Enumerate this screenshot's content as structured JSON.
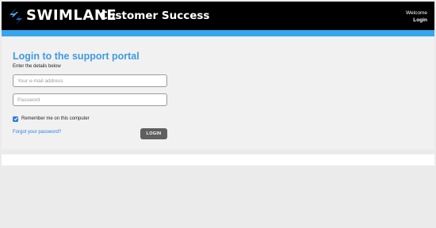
{
  "header": {
    "brand": "SWIMLANE",
    "product": "Customer Success",
    "welcome_text": "Welcome",
    "login_link": "Login",
    "logo_icon": "swimlane-logo-icon"
  },
  "login_form": {
    "title": "Login to the support portal",
    "subtitle": "Enter the details below",
    "email_placeholder": "Your e-mail address",
    "email_value": "",
    "password_placeholder": "Password",
    "password_value": "",
    "remember_label": "Remember me on this computer",
    "remember_checked": true,
    "forgot_link": "Forgot your password?",
    "login_button": "LOGIN"
  },
  "colors": {
    "header_bg": "#000000",
    "accent_bar": "#35a6ee",
    "title": "#3f9be0",
    "link": "#2f7fd8",
    "button": "#5f5f5f"
  }
}
